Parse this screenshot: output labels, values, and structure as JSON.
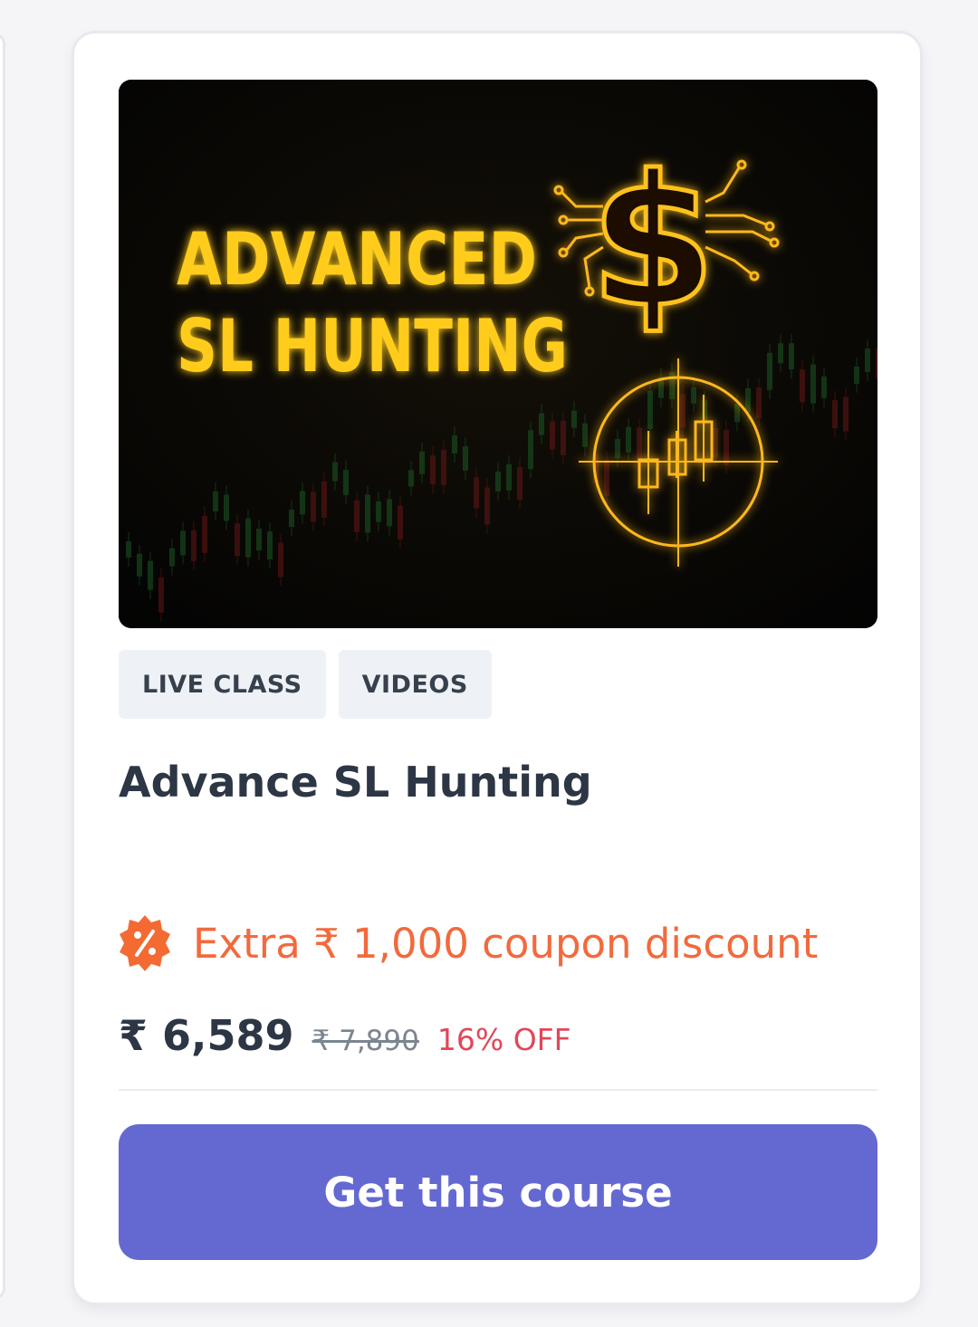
{
  "thumbnail": {
    "headline_line1": "ADVANCED",
    "headline_line2": "SL HUNTING",
    "dollar_symbol": "$",
    "accent_color": "#ffcc1a",
    "icons": [
      "dollar-circuit-icon",
      "crosshair-candlestick-icon"
    ]
  },
  "tags": [
    {
      "label": "LIVE CLASS"
    },
    {
      "label": "VIDEOS"
    }
  ],
  "course": {
    "title": "Advance SL Hunting"
  },
  "coupon": {
    "icon": "percent-badge-icon",
    "text": "Extra ₹ 1,000 coupon discount",
    "color": "#f26a3c"
  },
  "pricing": {
    "price": "₹ 6,589",
    "original_price": "₹ 7,890",
    "discount": "16% OFF",
    "discount_color": "#e0475a"
  },
  "cta": {
    "label": "Get this course",
    "color": "#6469d2"
  }
}
